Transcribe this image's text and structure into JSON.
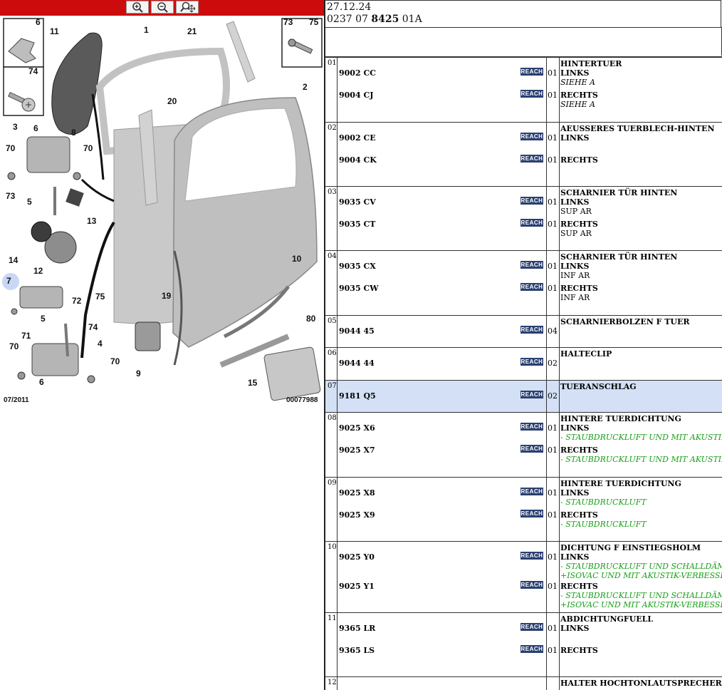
{
  "toolbar": {
    "zoom_in_icon": "zoom-in-icon",
    "zoom_out_icon": "zoom-out-icon",
    "zoom_fit_icon": "zoom-move-icon",
    "color": "#cc0c0c"
  },
  "diagram": {
    "callouts": [
      "6",
      "11",
      "1",
      "21",
      "73",
      "75",
      "74",
      "20",
      "2",
      "3",
      "6",
      "8",
      "70",
      "70",
      "5",
      "73",
      "13",
      "14",
      "12",
      "7",
      "72",
      "10",
      "75",
      "19",
      "5",
      "71",
      "74",
      "4",
      "80",
      "70",
      "70",
      "9",
      "6",
      "15"
    ],
    "date_label": "07/2011",
    "ref_label": "00077988"
  },
  "header": {
    "date": "27.12.24",
    "ref_prefix": "0237 07 ",
    "ref_bold": "8425",
    "ref_suffix": " 01A"
  },
  "reach_label": "REACH",
  "rows": [
    {
      "idx": "01",
      "title": "HINTERTUER",
      "selected": false,
      "height": 91,
      "items": [
        {
          "pn": "9002 CC",
          "qty": "01",
          "side": "LINKS",
          "notes": [
            {
              "t": "SIEHE A",
              "s": "it"
            }
          ]
        },
        {
          "pn": "9004 CJ",
          "qty": "01",
          "side": "RECHTS",
          "notes": [
            {
              "t": "SIEHE A",
              "s": "it"
            }
          ]
        }
      ]
    },
    {
      "idx": "02",
      "title": "AEUSSERES TUERBLECH-HINTEN",
      "selected": false,
      "height": 90,
      "items": [
        {
          "pn": "9002 CE",
          "qty": "01",
          "side": "LINKS",
          "notes": []
        },
        {
          "pn": "9004 CK",
          "qty": "01",
          "side": "RECHTS",
          "notes": []
        }
      ]
    },
    {
      "idx": "03",
      "title": "SCHARNIER TÜR HINTEN",
      "selected": false,
      "height": 90,
      "items": [
        {
          "pn": "9035 CV",
          "qty": "01",
          "side": "LINKS",
          "notes": [
            {
              "t": "SUP AR",
              "s": "n"
            }
          ]
        },
        {
          "pn": "9035 CT",
          "qty": "01",
          "side": "RECHTS",
          "notes": [
            {
              "t": "SUP AR",
              "s": "n"
            }
          ]
        }
      ]
    },
    {
      "idx": "04",
      "title": "SCHARNIER TÜR HINTEN",
      "selected": false,
      "height": 91,
      "items": [
        {
          "pn": "9035 CX",
          "qty": "01",
          "side": "LINKS",
          "notes": [
            {
              "t": "INF AR",
              "s": "n"
            }
          ]
        },
        {
          "pn": "9035 CW",
          "qty": "01",
          "side": "RECHTS",
          "notes": [
            {
              "t": "INF AR",
              "s": "n"
            }
          ]
        }
      ]
    },
    {
      "idx": "05",
      "title": "SCHARNIERBOLZEN F TUER",
      "selected": false,
      "height": 45,
      "items": [
        {
          "pn": "9044 45",
          "qty": "04",
          "side": "",
          "notes": []
        }
      ]
    },
    {
      "idx": "06",
      "title": "HALTECLIP",
      "selected": false,
      "height": 46,
      "items": [
        {
          "pn": "9044 44",
          "qty": "02",
          "side": "",
          "notes": []
        }
      ]
    },
    {
      "idx": "07",
      "title": "TUERANSCHLAG",
      "selected": true,
      "height": 45,
      "items": [
        {
          "pn": "9181 Q5",
          "qty": "02",
          "side": "",
          "notes": []
        }
      ]
    },
    {
      "idx": "08",
      "title": "HINTERE TUERDICHTUNG",
      "selected": false,
      "height": 91,
      "items": [
        {
          "pn": "9025 X6",
          "qty": "01",
          "side": "LINKS",
          "notes": [
            {
              "t": "- STAUBDRUCKLUFT UND MIT AKUSTIK-VERBESSERUNG",
              "s": "g"
            }
          ]
        },
        {
          "pn": "9025 X7",
          "qty": "01",
          "side": "RECHTS",
          "notes": [
            {
              "t": "- STAUBDRUCKLUFT UND MIT AKUSTIK-VERBESSERUNG",
              "s": "g"
            }
          ]
        }
      ]
    },
    {
      "idx": "09",
      "title": "HINTERE TUERDICHTUNG",
      "selected": false,
      "height": 90,
      "items": [
        {
          "pn": "9025 X8",
          "qty": "01",
          "side": "LINKS",
          "notes": [
            {
              "t": "- STAUBDRUCKLUFT",
              "s": "g"
            }
          ]
        },
        {
          "pn": "9025 X9",
          "qty": "01",
          "side": "RECHTS",
          "notes": [
            {
              "t": "- STAUBDRUCKLUFT",
              "s": "g"
            }
          ]
        }
      ]
    },
    {
      "idx": "10",
      "title": "DICHTUNG F EINSTIEGSHOLM",
      "selected": false,
      "height": 100,
      "items": [
        {
          "pn": "9025 Y0",
          "qty": "01",
          "side": "LINKS",
          "notes": [
            {
              "t": "- STAUBDRUCKLUFT UND SCHALLDÄMMUNG UND",
              "s": "g"
            },
            {
              "t": "+ISOVAC UND MIT AKUSTIK-VERBESSERUNG",
              "s": "g"
            }
          ]
        },
        {
          "pn": "9025 Y1",
          "qty": "01",
          "side": "RECHTS",
          "notes": [
            {
              "t": "- STAUBDRUCKLUFT UND SCHALLDÄMMUNG UND",
              "s": "g"
            },
            {
              "t": "+ISOVAC UND MIT AKUSTIK-VERBESSERUNG",
              "s": "g"
            }
          ]
        }
      ]
    },
    {
      "idx": "11",
      "title": "ABDICHTUNGFUELL",
      "selected": false,
      "height": 90,
      "items": [
        {
          "pn": "9365 LR",
          "qty": "01",
          "side": "LINKS",
          "notes": []
        },
        {
          "pn": "9365 LS",
          "qty": "01",
          "side": "RECHTS",
          "notes": []
        }
      ]
    },
    {
      "idx": "12",
      "title": "HALTER HOCHTONLAUTSPRECHER HI",
      "selected": false,
      "height": 30,
      "items": []
    }
  ]
}
